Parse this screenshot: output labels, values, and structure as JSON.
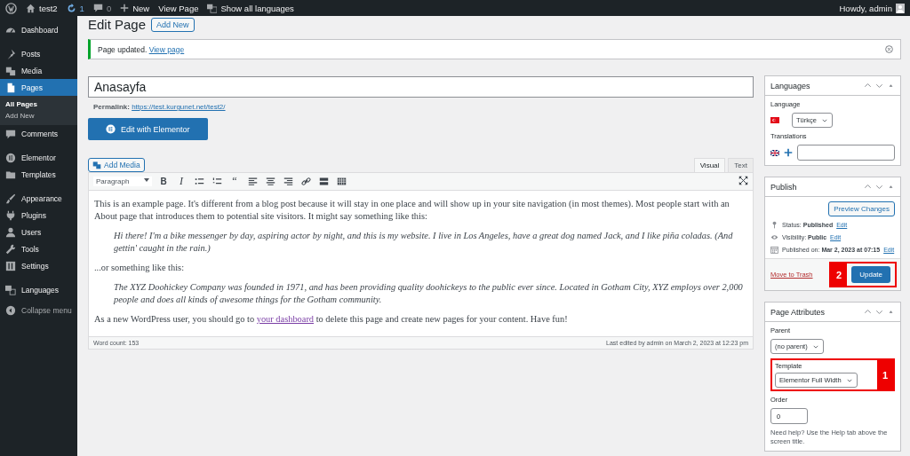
{
  "admin_bar": {
    "site": "test2",
    "updates": "1",
    "comments": "0",
    "new": "New",
    "view": "View Page",
    "languages": "Show all languages",
    "howdy": "Howdy, admin"
  },
  "sidebar": {
    "groups": [
      [
        {
          "label": "Dashboard",
          "selected": false
        }
      ],
      [
        {
          "label": "Posts",
          "selected": false
        },
        {
          "label": "Media",
          "selected": false
        },
        {
          "label": "Pages",
          "selected": true,
          "children": [
            {
              "label": "All Pages",
              "selected": true
            },
            {
              "label": "Add New",
              "selected": false
            }
          ]
        },
        {
          "label": "Comments",
          "selected": false
        }
      ],
      [
        {
          "label": "Elementor",
          "selected": false
        },
        {
          "label": "Templates",
          "selected": false
        }
      ],
      [
        {
          "label": "Appearance",
          "selected": false
        },
        {
          "label": "Plugins",
          "selected": false
        },
        {
          "label": "Users",
          "selected": false
        },
        {
          "label": "Tools",
          "selected": false
        },
        {
          "label": "Settings",
          "selected": false
        }
      ],
      [
        {
          "label": "Languages",
          "selected": false
        }
      ]
    ],
    "collapse": "Collapse menu"
  },
  "page": {
    "heading": "Edit Page",
    "add_new": "Add New",
    "notice": {
      "text": "Page updated.",
      "link": "View page"
    },
    "title": "Anasayfa",
    "permalink": {
      "label": "Permalink:",
      "url": "https://test.kurgunet.net/test2/"
    },
    "elementor_button": "Edit with Elementor",
    "add_media": "Add Media",
    "editor_tabs": [
      {
        "label": "Visual",
        "selected": true
      },
      {
        "label": "Text",
        "selected": false
      }
    ],
    "format": "Paragraph",
    "toolbar": [
      {
        "kind": "bold",
        "glyph": "B"
      },
      {
        "kind": "italic",
        "glyph": "I"
      },
      {
        "kind": "bullets"
      },
      {
        "kind": "numbers"
      },
      {
        "kind": "quote",
        "glyph": "“"
      },
      {
        "kind": "align-left"
      },
      {
        "kind": "align-center"
      },
      {
        "kind": "align-right"
      },
      {
        "kind": "link"
      },
      {
        "kind": "more"
      },
      {
        "kind": "toolbar"
      }
    ],
    "content": [
      {
        "kind": "p",
        "text": "This is an example page. It's different from a blog post because it will stay in one place and will show up in your site navigation (in most themes). Most people start with an About page that introduces them to potential site visitors. It might say something like this:"
      },
      {
        "kind": "quote",
        "text": "Hi there! I'm a bike messenger by day, aspiring actor by night, and this is my website. I live in Los Angeles, have a great dog named Jack, and I like piña coladas. (And gettin' caught in the rain.)"
      },
      {
        "kind": "p",
        "text": "...or something like this:"
      },
      {
        "kind": "quote",
        "text": "The XYZ Doohickey Company was founded in 1971, and has been providing quality doohickeys to the public ever since. Located in Gotham City, XYZ employs over 2,000 people and does all kinds of awesome things for the Gotham community."
      },
      {
        "kind": "p",
        "text": "As a new WordPress user, you should go to ",
        "link": "your dashboard",
        "after": " to delete this page and create new pages for your content. Have fun!"
      }
    ],
    "word_count": "Word count: 153",
    "last_edited": "Last edited by admin on March 2, 2023 at 12:23 pm"
  },
  "languages_box": {
    "title": "Languages",
    "language_label": "Language",
    "language": "Türkçe",
    "translations_label": "Translations"
  },
  "publish_box": {
    "title": "Publish",
    "preview": "Preview Changes",
    "rows": [
      {
        "kind": "status",
        "label": "Status:",
        "value": "Published",
        "link": "Edit"
      },
      {
        "kind": "visibility",
        "label": "Visibility:",
        "value": "Public",
        "link": "Edit"
      },
      {
        "kind": "date",
        "label": "Published on:",
        "value": "Mar 2, 2023 at 07:15",
        "link": "Edit"
      }
    ],
    "trash": "Move to Trash",
    "update": "Update",
    "callout": "2"
  },
  "attributes_box": {
    "title": "Page Attributes",
    "parent_label": "Parent",
    "parent": "(no parent)",
    "template_label": "Template",
    "template": "Elementor Full Width",
    "callout": "1",
    "order_label": "Order",
    "order": "0",
    "help": "Need help? Use the Help tab above the screen title."
  }
}
